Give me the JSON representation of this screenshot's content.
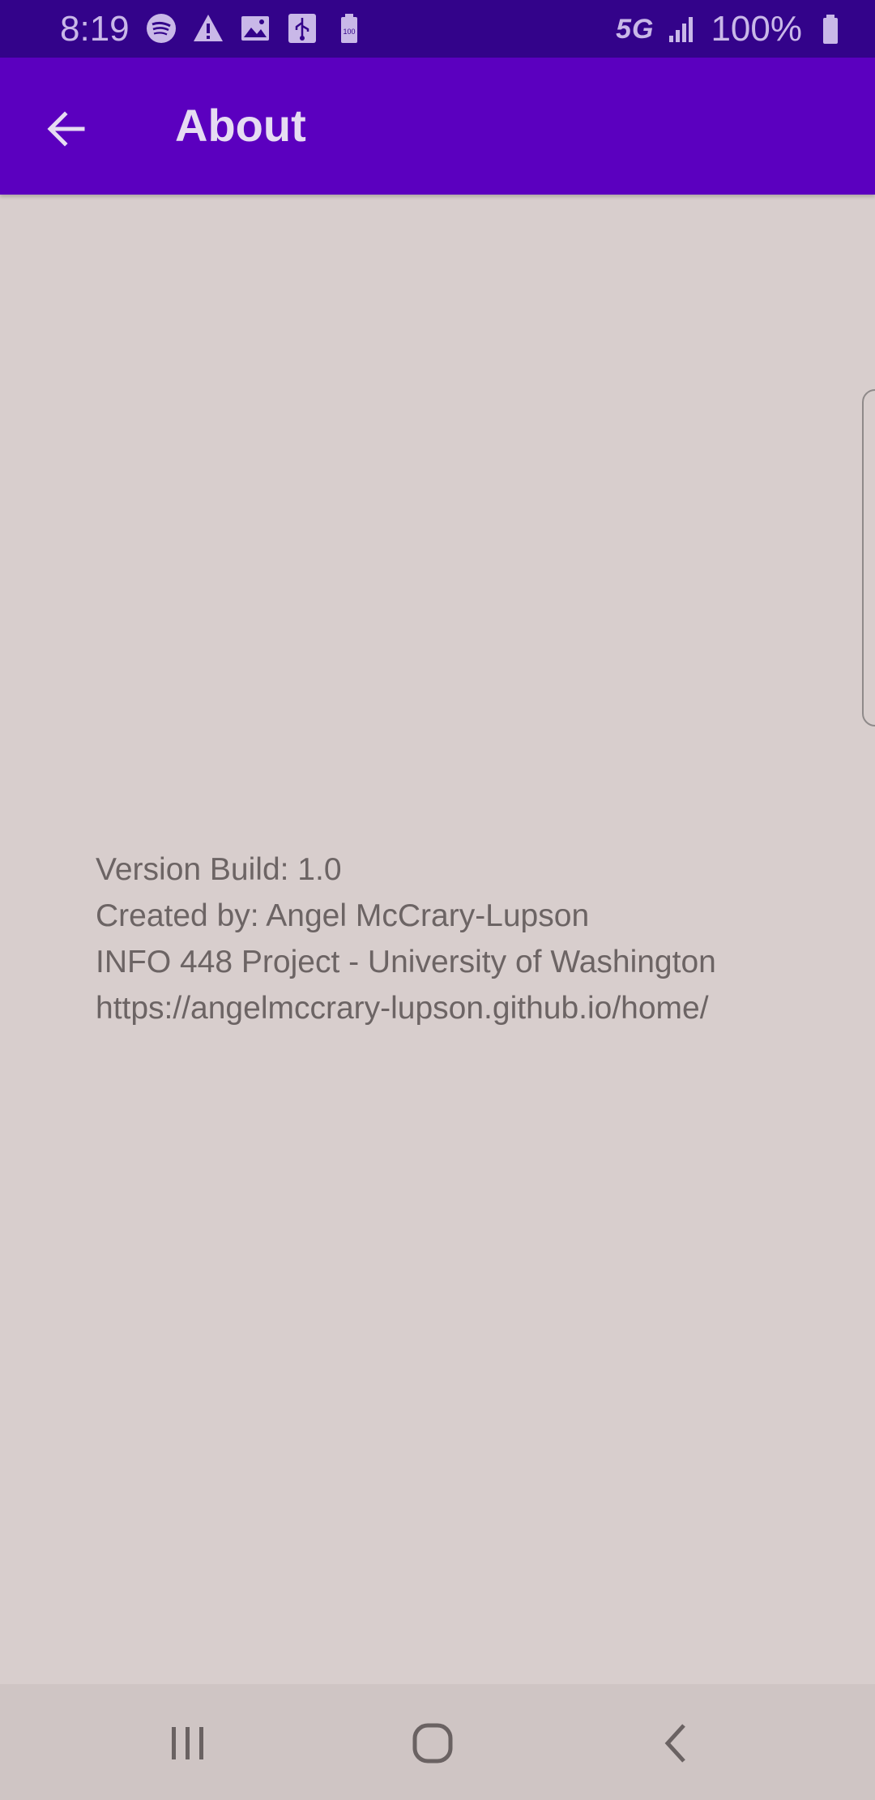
{
  "status_bar": {
    "time": "8:19",
    "battery_percent": "100%",
    "network_label": "5G",
    "notification_icons": [
      "spotify-icon",
      "alert-icon",
      "image-icon",
      "usb-icon",
      "battery-saver-icon"
    ],
    "right_icons": [
      "5g-icon",
      "signal-icon",
      "battery-icon"
    ]
  },
  "app_bar": {
    "title": "About",
    "back_icon": "arrow-back-icon",
    "background": "#5b00bf"
  },
  "about": {
    "version": "Version Build: 1.0",
    "author": "Created by: Angel McCrary-Lupson",
    "project": "INFO 448 Project - University of Washington",
    "url": "https://angelmccrary-lupson.github.io/home/"
  },
  "nav_bar": {
    "buttons": [
      "recents-icon",
      "home-icon",
      "back-icon"
    ]
  },
  "colors": {
    "status_bar": "#33038a",
    "background": "#d8cecd",
    "text": "#6c6464"
  }
}
